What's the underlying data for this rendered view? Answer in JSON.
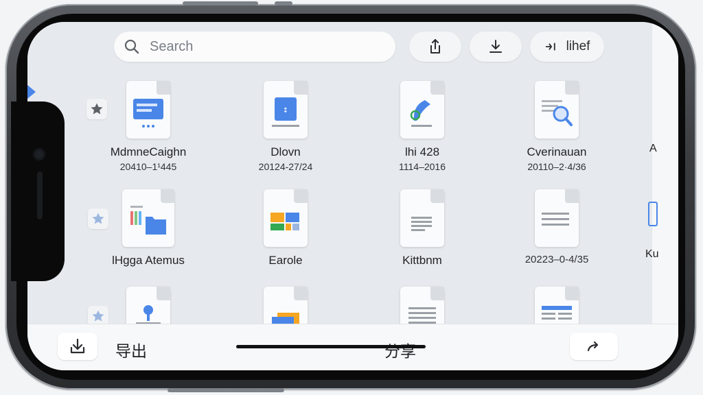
{
  "toolbar": {
    "search_placeholder": "Search",
    "share_icon": "share-icon",
    "download_icon": "download-icon",
    "move_label": "lihef"
  },
  "files": [
    {
      "name": "MdmneCaighn",
      "date": "20410–1¹445",
      "icon": "slides-doc-icon",
      "starred": true
    },
    {
      "name": "Dlovn",
      "date": "20124-27/24",
      "icon": "image-doc-icon"
    },
    {
      "name": "lhi 428",
      "date": "1114–2016",
      "icon": "pen-doc-icon"
    },
    {
      "name": "Cverinauan",
      "date": "20110–2·4/36",
      "icon": "search-doc-icon"
    },
    {
      "name": "lHgga Atemus",
      "date": "",
      "icon": "folder-doc-icon",
      "starred": true
    },
    {
      "name": "Earole",
      "date": "",
      "icon": "spreadsheet-doc-icon"
    },
    {
      "name": "Kittbnm",
      "date": "",
      "icon": "text-doc-icon"
    },
    {
      "name": "",
      "date": "20223–0-4/35",
      "icon": "lines-doc-icon"
    },
    {
      "name": "",
      "date": "",
      "icon": "pin-doc-icon",
      "starred": true
    },
    {
      "name": "",
      "date": "",
      "icon": "color-doc-icon"
    },
    {
      "name": "",
      "date": "",
      "icon": "text-doc-icon"
    },
    {
      "name": "",
      "date": "",
      "icon": "table-doc-icon"
    }
  ],
  "partials": {
    "row1": "A",
    "row2": "Ku"
  },
  "bottom": {
    "export_label": "导出",
    "share_label": "分享"
  },
  "colors": {
    "accent": "#4a86e8",
    "background": "#e6e9ed",
    "bar": "#f7f8f9"
  }
}
